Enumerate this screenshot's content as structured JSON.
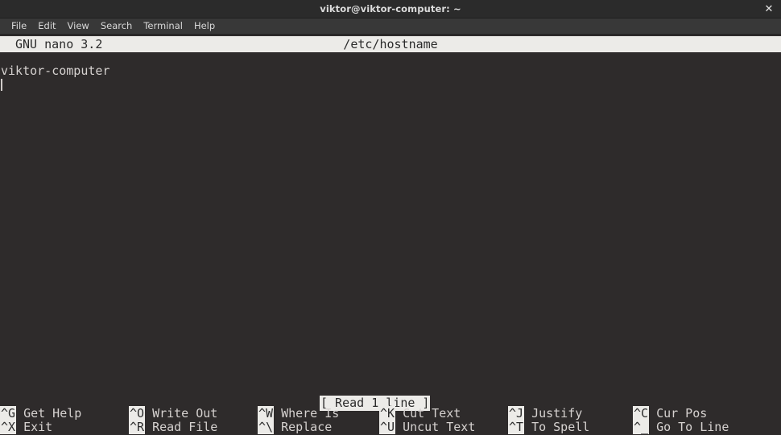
{
  "window": {
    "title": "viktor@viktor-computer: ~",
    "close_icon": "close-icon",
    "close_glyph": "✕"
  },
  "menubar": {
    "items": [
      {
        "label": "File"
      },
      {
        "label": "Edit"
      },
      {
        "label": "View"
      },
      {
        "label": "Search"
      },
      {
        "label": "Terminal"
      },
      {
        "label": "Help"
      }
    ]
  },
  "nano": {
    "version": "GNU nano 3.2",
    "filename": "/etc/hostname",
    "buffer_lines": [
      "viktor-computer"
    ],
    "status_message": "[ Read 1 line ]",
    "shortcuts": [
      {
        "key": "^G",
        "label": "Get Help",
        "col": 0,
        "row": 0
      },
      {
        "key": "^X",
        "label": "Exit",
        "col": 0,
        "row": 1
      },
      {
        "key": "^O",
        "label": "Write Out",
        "col": 1,
        "row": 0
      },
      {
        "key": "^R",
        "label": "Read File",
        "col": 1,
        "row": 1
      },
      {
        "key": "^W",
        "label": "Where Is",
        "col": 2,
        "row": 0
      },
      {
        "key": "^\\",
        "label": "Replace",
        "col": 2,
        "row": 1
      },
      {
        "key": "^K",
        "label": "Cut Text",
        "col": 3,
        "row": 0
      },
      {
        "key": "^U",
        "label": "Uncut Text",
        "col": 3,
        "row": 1
      },
      {
        "key": "^J",
        "label": "Justify",
        "col": 4,
        "row": 0
      },
      {
        "key": "^T",
        "label": "To Spell",
        "col": 4,
        "row": 1
      },
      {
        "key": "^C",
        "label": "Cur Pos",
        "col": 5,
        "row": 0
      },
      {
        "key": "^_",
        "label": "Go To Line",
        "col": 5,
        "row": 1
      }
    ]
  },
  "colors": {
    "titlebar_bg": "#2b2b2b",
    "menubar_bg": "#383838",
    "terminal_bg": "#2e2b2b",
    "terminal_fg": "#d6d2d0",
    "inverse_bg": "#ecebe8",
    "inverse_fg": "#2b2b2b"
  }
}
